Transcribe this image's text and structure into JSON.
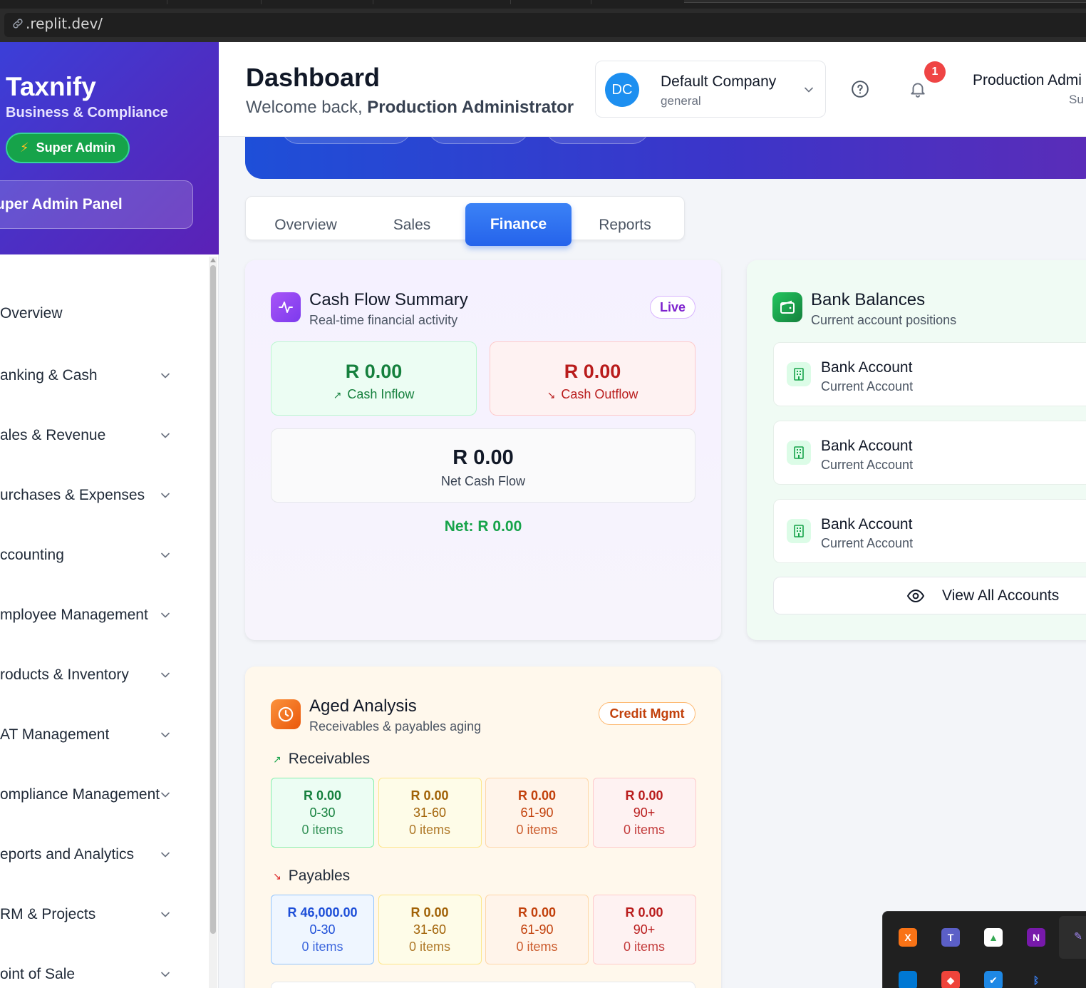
{
  "browser": {
    "url": ".replit.dev/"
  },
  "sidebar": {
    "brand": "Taxnify",
    "tagline": "Business & Compliance",
    "role_badge": "Super Admin",
    "panel_button": "uper Admin Panel",
    "items": [
      {
        "label": "Overview",
        "has_chevron": false
      },
      {
        "label": "anking & Cash",
        "has_chevron": true
      },
      {
        "label": "ales & Revenue",
        "has_chevron": true
      },
      {
        "label": "urchases & Expenses",
        "has_chevron": true
      },
      {
        "label": "ccounting",
        "has_chevron": true
      },
      {
        "label": "mployee Management",
        "has_chevron": true
      },
      {
        "label": "roducts & Inventory",
        "has_chevron": true
      },
      {
        "label": "AT Management",
        "has_chevron": true
      },
      {
        "label": "ompliance Management",
        "has_chevron": true
      },
      {
        "label": "eports and Analytics",
        "has_chevron": true
      },
      {
        "label": "RM & Projects",
        "has_chevron": true
      },
      {
        "label": "oint of Sale",
        "has_chevron": true
      }
    ]
  },
  "header": {
    "title": "Dashboard",
    "welcome_prefix": "Welcome back,",
    "welcome_name": "Production Administrator",
    "company": {
      "initials": "DC",
      "name": "Default Company",
      "type": "general"
    },
    "notification_count": "1",
    "user": {
      "name": "Production Admi",
      "role": "Su"
    }
  },
  "tabs": [
    {
      "label": "Overview",
      "active": false
    },
    {
      "label": "Sales",
      "active": false
    },
    {
      "label": "Finance",
      "active": true
    },
    {
      "label": "Reports",
      "active": false
    }
  ],
  "cash_flow": {
    "title": "Cash Flow Summary",
    "subtitle": "Real-time financial activity",
    "badge": "Live",
    "inflow": {
      "amount": "R 0.00",
      "label": "Cash Inflow"
    },
    "outflow": {
      "amount": "R 0.00",
      "label": "Cash Outflow"
    },
    "net": {
      "amount": "R 0.00",
      "label": "Net Cash Flow"
    },
    "net_line": "Net: R 0.00"
  },
  "bank_balances": {
    "title": "Bank Balances",
    "subtitle": "Current account positions",
    "accounts": [
      {
        "name": "Bank Account",
        "type": "Current Account"
      },
      {
        "name": "Bank Account",
        "type": "Current Account"
      },
      {
        "name": "Bank Account",
        "type": "Current Account"
      }
    ],
    "view_all": "View All Accounts"
  },
  "aged_analysis": {
    "title": "Aged Analysis",
    "subtitle": "Receivables & payables aging",
    "badge": "Credit Mgmt",
    "receivables": {
      "label": "Receivables",
      "buckets": [
        {
          "amount": "R 0.00",
          "range": "0-30",
          "count": "0 items"
        },
        {
          "amount": "R 0.00",
          "range": "31-60",
          "count": "0 items"
        },
        {
          "amount": "R 0.00",
          "range": "61-90",
          "count": "0 items"
        },
        {
          "amount": "R 0.00",
          "range": "90+",
          "count": "0 items"
        }
      ]
    },
    "payables": {
      "label": "Payables",
      "buckets": [
        {
          "amount": "R 46,000.00",
          "range": "0-30",
          "count": "0 items"
        },
        {
          "amount": "R 0.00",
          "range": "31-60",
          "count": "0 items"
        },
        {
          "amount": "R 0.00",
          "range": "61-90",
          "count": "0 items"
        },
        {
          "amount": "R 0.00",
          "range": "90+",
          "count": "0 items"
        }
      ]
    }
  },
  "colors": {
    "primary": "#2563eb",
    "sidebar_gradient_start": "#3b3fd8",
    "sidebar_gradient_end": "#5b21b6",
    "success": "#16a34a",
    "danger": "#b91c1c",
    "purple_icon": "#8b5cf6",
    "green_icon": "#16a34a",
    "orange_icon": "#f97316"
  },
  "tray_icons": [
    "xampp-icon",
    "teams-icon",
    "google-drive-icon",
    "onenote-icon",
    "pen-icon",
    "windows-app-icon",
    "anydesk-icon",
    "defender-icon",
    "bluetooth-icon"
  ]
}
